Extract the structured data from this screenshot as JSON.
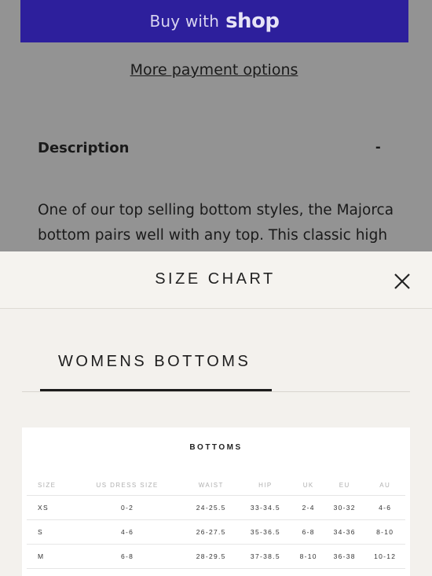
{
  "product_page": {
    "shop_pay": {
      "buy_label": "Buy with",
      "brand_label": "shop",
      "color": "#2d1f9c"
    },
    "more_payment_options": "More payment options",
    "description": {
      "heading": "Description",
      "toggle": "-",
      "text": "One of our top selling bottom styles, the Majorca bottom pairs well with any top. This classic high"
    }
  },
  "size_chart_modal": {
    "title": "SIZE CHART",
    "close_icon": "close-icon",
    "tabs": [
      {
        "label": "WOMENS BOTTOMS",
        "active": true
      }
    ],
    "table": {
      "title": "BOTTOMS",
      "columns": [
        "SIZE",
        "US DRESS SIZE",
        "WAIST",
        "HIP",
        "UK",
        "EU",
        "AU"
      ],
      "rows": [
        [
          "XS",
          "0-2",
          "24-25.5",
          "33-34.5",
          "2-4",
          "30-32",
          "4-6"
        ],
        [
          "S",
          "4-6",
          "26-27.5",
          "35-36.5",
          "6-8",
          "34-36",
          "8-10"
        ],
        [
          "M",
          "6-8",
          "28-29.5",
          "37-38.5",
          "8-10",
          "36-38",
          "10-12"
        ]
      ]
    }
  }
}
